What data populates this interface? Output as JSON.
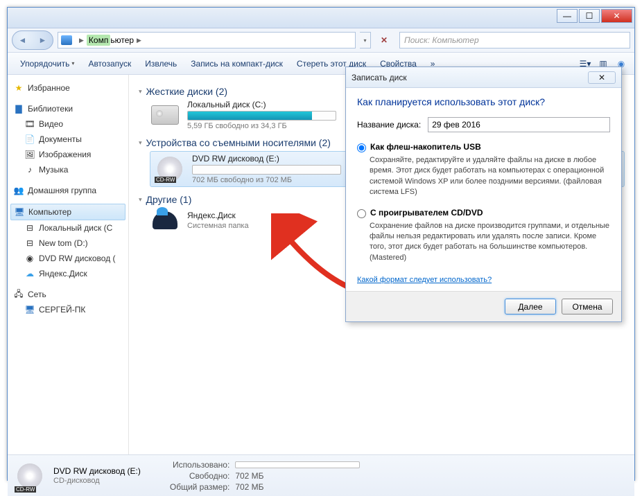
{
  "breadcrumb": {
    "root_hl": "Комп",
    "root_rest": "ьютер"
  },
  "search": {
    "placeholder": "Поиск: Компьютер"
  },
  "toolbar": {
    "organize": "Упорядочить",
    "autoplay": "Автозапуск",
    "eject": "Извлечь",
    "burn": "Запись на компакт-диск",
    "erase": "Стереть этот диск",
    "properties": "Свойства"
  },
  "sidebar": {
    "favorites": "Избранное",
    "libraries": "Библиотеки",
    "lib_items": {
      "video": "Видео",
      "docs": "Документы",
      "images": "Изображения",
      "music": "Музыка"
    },
    "homegroup": "Домашняя группа",
    "computer": "Компьютер",
    "drives": {
      "c": "Локальный диск (C",
      "d": "New tom (D:)",
      "e": "DVD RW дисковод (",
      "y": "Яндекс.Диск"
    },
    "network": "Сеть",
    "pc": "СЕРГЕЙ-ПК"
  },
  "sections": {
    "hdd": "Жесткие диски (2)",
    "removable": "Устройства со съемными носителями (2)",
    "other": "Другие (1)"
  },
  "drive_c": {
    "name": "Локальный диск (C:)",
    "free": "5,59 ГБ свободно из 34,3 ГБ"
  },
  "drive_e": {
    "name": "DVD RW дисковод (E:)",
    "free": "702 МБ свободно из 702 МБ",
    "badge": "CD-RW"
  },
  "drive_y": {
    "name": "Яндекс.Диск",
    "sub": "Системная папка"
  },
  "status": {
    "name": "DVD RW дисковод (E:)",
    "type": "CD-дисковод",
    "used_k": "Использовано:",
    "free_k": "Свободно:",
    "free_v": "702 МБ",
    "total_k": "Общий размер:",
    "total_v": "702 МБ"
  },
  "dialog": {
    "title": "Записать диск",
    "heading": "Как планируется использовать этот диск?",
    "name_label": "Название диска:",
    "name_value": "29 фев 2016",
    "opt1_label": "Как флеш-накопитель USB",
    "opt1_desc": "Сохраняйте, редактируйте и удаляйте файлы на диске в любое время. Этот диск будет работать на компьютерах с операционной системой Windows XP или более поздними версиями. (файловая система LFS)",
    "opt2_label": "С проигрывателем CD/DVD",
    "opt2_desc": "Сохранение файлов на диске производится группами, и отдельные файлы нельзя редактировать или удалять после записи. Кроме того, этот диск будет работать на большинстве компьютеров. (Mastered)",
    "link": "Какой формат следует использовать?",
    "next": "Далее",
    "cancel": "Отмена"
  }
}
